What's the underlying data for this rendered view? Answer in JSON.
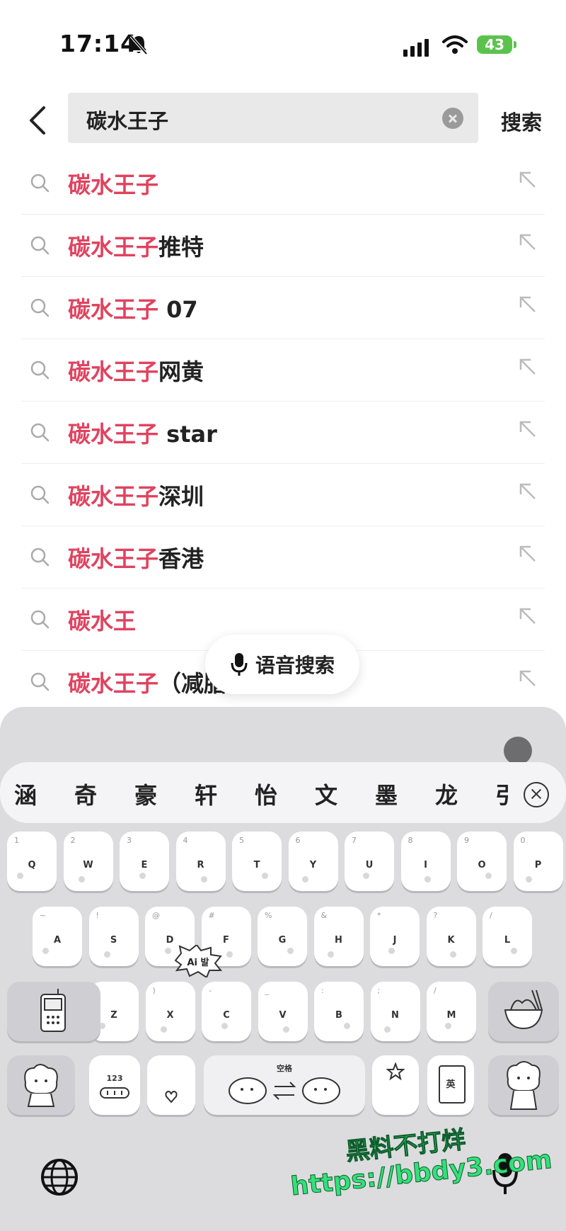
{
  "status_bar": {
    "time": "17:14",
    "battery": "43"
  },
  "search": {
    "query": "碳水王子",
    "submit_label": "搜索"
  },
  "suggestions": [
    {
      "highlight": "碳水王子",
      "rest": ""
    },
    {
      "highlight": "碳水王子",
      "rest": "推特"
    },
    {
      "highlight": "碳水王子",
      "rest": " 07"
    },
    {
      "highlight": "碳水王子",
      "rest": "网黄"
    },
    {
      "highlight": "碳水王子",
      "rest": " star"
    },
    {
      "highlight": "碳水王子",
      "rest": "深圳"
    },
    {
      "highlight": "碳水王子",
      "rest": "香港"
    },
    {
      "highlight": "碳水王",
      "rest": ""
    },
    {
      "highlight": "碳水王子",
      "rest": "（减脂"
    }
  ],
  "voice_search": {
    "label": "语音搜索"
  },
  "keyboard": {
    "candidates": [
      "涵",
      "奇",
      "豪",
      "轩",
      "怡",
      "文",
      "墨",
      "龙",
      "引"
    ],
    "row1": [
      {
        "num": "1",
        "key": "Q"
      },
      {
        "num": "2",
        "key": "W"
      },
      {
        "num": "3",
        "key": "E"
      },
      {
        "num": "4",
        "key": "R"
      },
      {
        "num": "5",
        "key": "T"
      },
      {
        "num": "6",
        "key": "Y"
      },
      {
        "num": "7",
        "key": "U"
      },
      {
        "num": "8",
        "key": "I"
      },
      {
        "num": "9",
        "key": "O"
      },
      {
        "num": "0",
        "key": "P"
      }
    ],
    "row2": [
      {
        "num": "~",
        "key": "A"
      },
      {
        "num": "!",
        "key": "S"
      },
      {
        "num": "@",
        "key": "D"
      },
      {
        "num": "#",
        "key": "F"
      },
      {
        "num": "%",
        "key": "G"
      },
      {
        "num": "&",
        "key": "H"
      },
      {
        "num": "*",
        "key": "J"
      },
      {
        "num": "?",
        "key": "K"
      },
      {
        "num": "/",
        "key": "L"
      }
    ],
    "row3": [
      {
        "num": "(",
        "key": "Z"
      },
      {
        "num": ")",
        "key": "X"
      },
      {
        "num": "-",
        "key": "C"
      },
      {
        "num": "_",
        "key": "V"
      },
      {
        "num": ":",
        "key": "B"
      },
      {
        "num": ";",
        "key": "N"
      },
      {
        "num": "/",
        "key": "M"
      }
    ],
    "numbers_key": "123",
    "space_label": "空格",
    "lang_key": "英",
    "sticker_text": "Ai 발"
  },
  "watermark": {
    "line1": "黑料不打烊",
    "line2": "https://bbdy3.com"
  },
  "colors": {
    "highlight": "#e0435f",
    "watermark": "#33e07a"
  }
}
